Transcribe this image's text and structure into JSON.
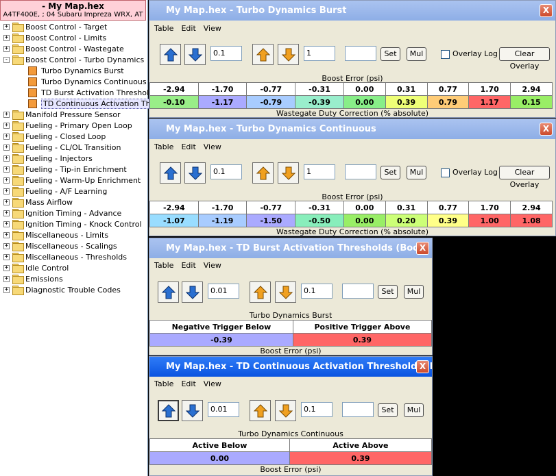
{
  "tree": {
    "title": "- My Map.hex",
    "subtitle": "A4TF400E, ; 04 Subaru Impreza WRX, AT",
    "items": [
      {
        "label": "Boost Control - Target",
        "kind": "folder",
        "expander": "+"
      },
      {
        "label": "Boost Control - Limits",
        "kind": "folder",
        "expander": "+"
      },
      {
        "label": "Boost Control - Wastegate",
        "kind": "folder",
        "expander": "+"
      },
      {
        "label": "Boost Control - Turbo Dynamics",
        "kind": "folder",
        "expander": "-"
      },
      {
        "label": "Turbo Dynamics Burst",
        "kind": "table"
      },
      {
        "label": "Turbo Dynamics Continuous",
        "kind": "table"
      },
      {
        "label": "TD Burst Activation Thresholds",
        "kind": "table"
      },
      {
        "label": "TD Continuous Activation Thres",
        "kind": "table",
        "selected": true
      },
      {
        "label": "Manifold Pressure Sensor",
        "kind": "folder",
        "expander": "+"
      },
      {
        "label": "Fueling - Primary Open Loop",
        "kind": "folder",
        "expander": "+"
      },
      {
        "label": "Fueling - Closed Loop",
        "kind": "folder",
        "expander": "+"
      },
      {
        "label": "Fueling - CL/OL Transition",
        "kind": "folder",
        "expander": "+"
      },
      {
        "label": "Fueling - Injectors",
        "kind": "folder",
        "expander": "+"
      },
      {
        "label": "Fueling - Tip-in Enrichment",
        "kind": "folder",
        "expander": "+"
      },
      {
        "label": "Fueling - Warm-Up Enrichment",
        "kind": "folder",
        "expander": "+"
      },
      {
        "label": "Fueling - A/F Learning",
        "kind": "folder",
        "expander": "+"
      },
      {
        "label": "Mass Airflow",
        "kind": "folder",
        "expander": "+"
      },
      {
        "label": "Ignition Timing - Advance",
        "kind": "folder",
        "expander": "+"
      },
      {
        "label": "Ignition Timing - Knock Control",
        "kind": "folder",
        "expander": "+"
      },
      {
        "label": "Miscellaneous - Limits",
        "kind": "folder",
        "expander": "+"
      },
      {
        "label": "Miscellaneous - Scalings",
        "kind": "folder",
        "expander": "+"
      },
      {
        "label": "Miscellaneous - Thresholds",
        "kind": "folder",
        "expander": "+"
      },
      {
        "label": "Idle Control",
        "kind": "folder",
        "expander": "+"
      },
      {
        "label": "Emissions",
        "kind": "folder",
        "expander": "+"
      },
      {
        "label": "Diagnostic Trouble Codes",
        "kind": "folder",
        "expander": "+"
      }
    ]
  },
  "menu": {
    "table": "Table",
    "edit": "Edit",
    "view": "View"
  },
  "buttons": {
    "set": "Set",
    "mul": "Mul",
    "overlay_log": "Overlay Log",
    "clear_overlay": "Clear Overlay",
    "close": "X"
  },
  "windows": {
    "burst": {
      "title": "My Map.hex - Turbo Dynamics Burst",
      "step_small": "0.1",
      "step_large": "1",
      "value": "",
      "x_axis_label": "Boost Error (psi)",
      "y_axis_label": "Wastegate Duty Correction (% absolute)",
      "x_values": [
        "-2.94",
        "-1.70",
        "-0.77",
        "-0.31",
        "0.00",
        "0.31",
        "0.77",
        "1.70",
        "2.94"
      ],
      "values": [
        "-0.10",
        "-1.17",
        "-0.79",
        "-0.39",
        "0.00",
        "0.39",
        "0.79",
        "1.17",
        "0.15"
      ],
      "colors": [
        "#99ee88",
        "#aaaaff",
        "#a8ccff",
        "#99eecc",
        "#88ee88",
        "#eeff77",
        "#ffcc77",
        "#ff6666",
        "#99ee66"
      ]
    },
    "continuous": {
      "title": "My Map.hex - Turbo Dynamics Continuous",
      "step_small": "0.1",
      "step_large": "1",
      "value": "",
      "x_axis_label": "Boost Error (psi)",
      "y_axis_label": "Wastegate Duty Correction (% absolute)",
      "x_values": [
        "-2.94",
        "-1.70",
        "-0.77",
        "-0.31",
        "0.00",
        "0.31",
        "0.77",
        "1.70",
        "2.94"
      ],
      "values": [
        "-1.07",
        "-1.19",
        "-1.50",
        "-0.50",
        "0.00",
        "0.20",
        "0.39",
        "1.00",
        "1.08"
      ],
      "colors": [
        "#99ddff",
        "#a8ccff",
        "#aaaaff",
        "#88eebb",
        "#99ee66",
        "#ccff77",
        "#ffff88",
        "#ff6666",
        "#ff6666"
      ]
    },
    "burst_thresholds": {
      "title": "My Map.hex - TD Burst Activation Thresholds (Boost Error)",
      "step_small": "0.01",
      "step_large": "0.1",
      "value": "",
      "caption": "Turbo Dynamics Burst",
      "headers": [
        "Negative Trigger Below",
        "Positive Trigger Above"
      ],
      "values": [
        "-0.39",
        "0.39"
      ],
      "colors": [
        "#aaaaff",
        "#ff6666"
      ],
      "footer": "Boost Error (psi)"
    },
    "continuous_thresholds": {
      "title": "My Map.hex - TD Continuous Activation Thresholds (Boo...",
      "step_small": "0.01",
      "step_large": "0.1",
      "value": "",
      "caption": "Turbo Dynamics Continuous",
      "headers": [
        "Active Below",
        "Active Above"
      ],
      "values": [
        "0.00",
        "0.39"
      ],
      "colors": [
        "#aaaaff",
        "#ff6666"
      ],
      "footer": "Boost Error (psi)"
    }
  }
}
